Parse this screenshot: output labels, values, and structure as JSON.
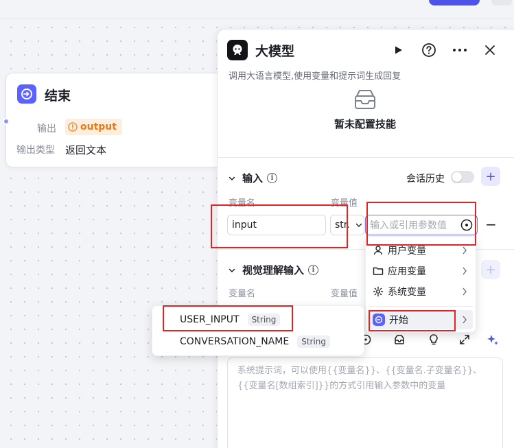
{
  "end_node": {
    "title": "结束",
    "output_label": "输出",
    "output_value": "output",
    "output_type_label": "输出类型",
    "output_type_value": "返回文本"
  },
  "panel": {
    "title": "大模型",
    "description": "调用大语言模型,使用变量和提示词生成回复",
    "skill_empty": "暂未配置技能",
    "input_section": {
      "title": "输入",
      "history_label": "会话历史",
      "add_label": "+",
      "col_name": "变量名",
      "col_value": "变量值",
      "name_value": "input",
      "type_value": "str.",
      "value_placeholder": "输入或引用参数值",
      "remove_label": "−"
    },
    "vision_section": {
      "title": "视觉理解输入",
      "add_label": "+",
      "col_name": "变量名",
      "col_value": "变量值"
    },
    "prompt_placeholder": "系统提示词，可以使用{{变量名}}、{{变量名.子变量名}}、{{变量名[数组索引]}}的方式引用输入参数中的变量"
  },
  "menu": {
    "items": [
      {
        "label": "用户变量",
        "icon": "user-icon"
      },
      {
        "label": "应用变量",
        "icon": "folder-icon"
      },
      {
        "label": "系统变量",
        "icon": "gear-icon"
      }
    ],
    "start": {
      "label": "开始",
      "icon": "start-node-icon"
    }
  },
  "submenu": {
    "items": [
      {
        "name": "USER_INPUT",
        "type": "String"
      },
      {
        "name": "CONVERSATION_NAME",
        "type": "String"
      }
    ]
  },
  "colors": {
    "accent": "#4d53e8",
    "output_tag": "#ee7a14",
    "highlight": "#e02424"
  }
}
